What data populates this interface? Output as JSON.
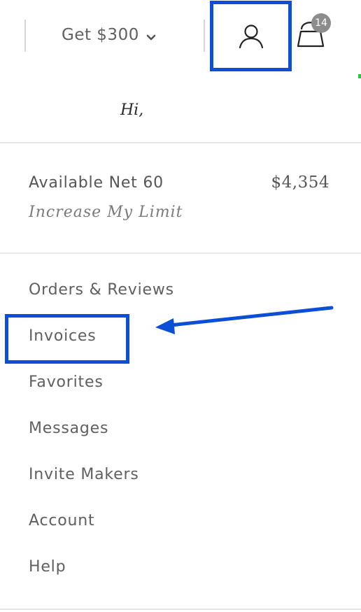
{
  "header": {
    "promo_label": "Get $300",
    "promo_chevron_icon": "chevron-down-icon",
    "account_icon": "user-icon",
    "cart_icon": "shopping-bag-icon",
    "cart_count": "14"
  },
  "greeting": "Hi,",
  "credit": {
    "label": "Available Net 60",
    "amount": "$4,354",
    "increase_link": "Increase My Limit"
  },
  "menu": {
    "items": [
      {
        "label": "Orders & Reviews"
      },
      {
        "label": "Invoices"
      },
      {
        "label": "Favorites"
      },
      {
        "label": "Messages"
      },
      {
        "label": "Invite Makers"
      },
      {
        "label": "Account"
      },
      {
        "label": "Help"
      }
    ]
  },
  "colors": {
    "highlight": "#0a4fd6",
    "badge": "#8c8c8c",
    "text": "#5f5f5f",
    "divider": "#e6e6e6",
    "accent_green": "#2cc83a"
  }
}
